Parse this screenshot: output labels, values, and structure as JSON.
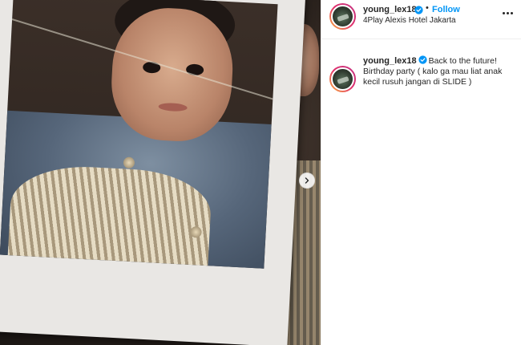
{
  "post": {
    "username": "young_lex18",
    "follow_label": "Follow",
    "separator": "•",
    "location": "4Play Alexis Hotel Jakarta",
    "caption_text": "Back to the future! Birthday party ( kalo ga mau liat anak kecil rusuh jangan di SLIDE )"
  },
  "icons": {
    "verified": "verified-badge-icon",
    "more": "more-options-icon",
    "next": "chevron-right-icon"
  },
  "colors": {
    "accent": "#0095f6",
    "text": "#262626",
    "verified": "#0095f6"
  }
}
